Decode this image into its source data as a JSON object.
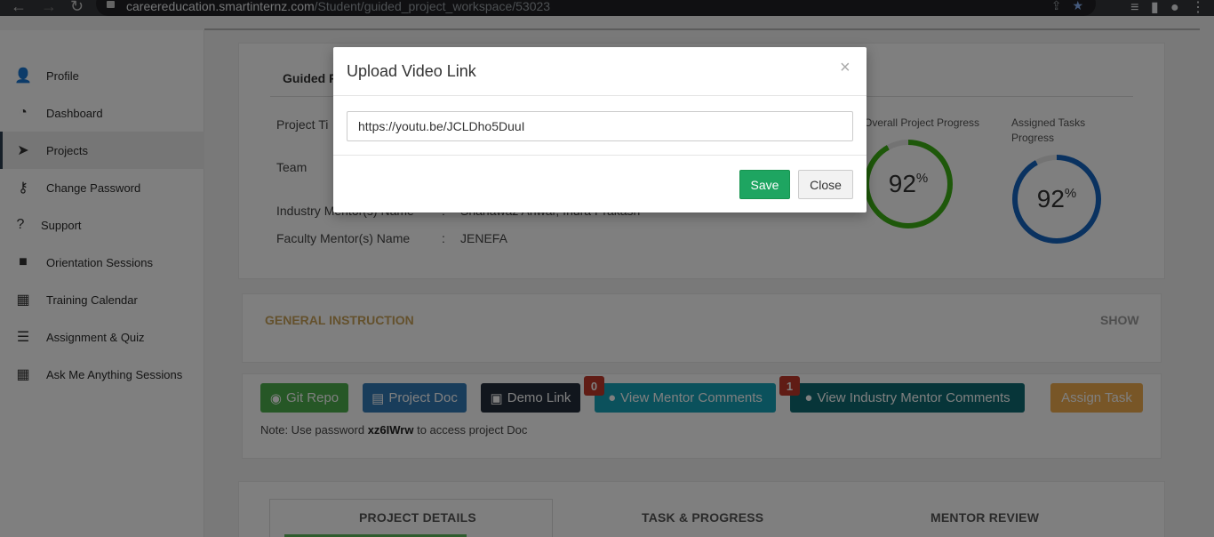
{
  "browser": {
    "url_host": "careereducation.smartinternz.com",
    "url_path": "/Student/guided_project_workspace/53023"
  },
  "sidebar": {
    "items": [
      {
        "label": "Profile",
        "icon": "user-icon"
      },
      {
        "label": "Dashboard",
        "icon": "dashboard-icon"
      },
      {
        "label": "Projects",
        "icon": "paper-plane-icon"
      },
      {
        "label": "Change Password",
        "icon": "key-icon"
      },
      {
        "label": "Support",
        "icon": "question-icon"
      },
      {
        "label": "Orientation Sessions",
        "icon": "video-camera-icon"
      },
      {
        "label": "Training Calendar",
        "icon": "calendar-icon"
      },
      {
        "label": "Assignment & Quiz",
        "icon": "list-icon"
      },
      {
        "label": "Ask Me Anything Sessions",
        "icon": "calendar-icon"
      }
    ]
  },
  "project": {
    "guided_title": "Guided P",
    "labels": {
      "project_title": "Project Ti",
      "team": "Team",
      "industry_mentor": "Industry Mentor(s) Name",
      "faculty_mentor": "Faculty Mentor(s) Name"
    },
    "colon": ":",
    "values": {
      "industry_mentor": "Shahawaz Anwar, Indra Prakash",
      "faculty_mentor": "JENEFA"
    },
    "overall_progress_label": "Overall Project Progress",
    "assigned_tasks_label": "Assigned Tasks Progress",
    "overall_progress": 92,
    "assigned_tasks_progress": 92,
    "percent_sign": "%",
    "overall_color": "#3cb014",
    "assigned_color": "#1565c0"
  },
  "instructions": {
    "title": "GENERAL INSTRUCTION",
    "toggle": "SHOW"
  },
  "actions": {
    "git_repo": "Git Repo",
    "project_doc": "Project Doc",
    "demo_link": "Demo Link",
    "view_mentor_comments": "View Mentor Comments",
    "mentor_comments_count": "0",
    "view_industry_mentor_comments": "View Industry Mentor Comments",
    "industry_comments_count": "1",
    "assign_task": "Assign Task",
    "note_prefix": "Note: Use password",
    "note_password": "xz6IWrw",
    "note_suffix": "to access project Doc"
  },
  "tabs": [
    {
      "label": "PROJECT DETAILS"
    },
    {
      "label": "TASK & PROGRESS"
    },
    {
      "label": "MENTOR REVIEW"
    }
  ],
  "modal": {
    "title": "Upload Video Link",
    "close_x": "×",
    "input_value": "https://youtu.be/JCLDho5DuuI",
    "save_label": "Save",
    "close_label": "Close"
  }
}
